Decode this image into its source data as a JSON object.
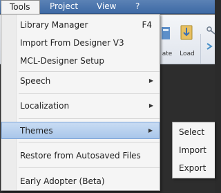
{
  "menubar": {
    "items": [
      "Tools",
      "Project",
      "View",
      "?"
    ]
  },
  "toolbar": {
    "update_label": "ate",
    "load_label": "Load"
  },
  "tools_menu": {
    "library_manager": {
      "label": "Library Manager",
      "shortcut": "F4"
    },
    "import_designer": {
      "label": "Import From Designer V3"
    },
    "mcl_setup": {
      "label": "MCL-Designer Setup"
    },
    "speech": {
      "label": "Speech",
      "arrow": "▶"
    },
    "localization": {
      "label": "Localization",
      "arrow": "▶"
    },
    "themes": {
      "label": "Themes",
      "arrow": "▶"
    },
    "restore": {
      "label": "Restore from Autosaved Files"
    },
    "early_adopter": {
      "label": "Early Adopter (Beta)"
    }
  },
  "themes_submenu": {
    "items": [
      "Select",
      "Import",
      "Export"
    ]
  },
  "colors": {
    "menubar": "#4a74ad",
    "highlight": "#b9d1ee"
  }
}
